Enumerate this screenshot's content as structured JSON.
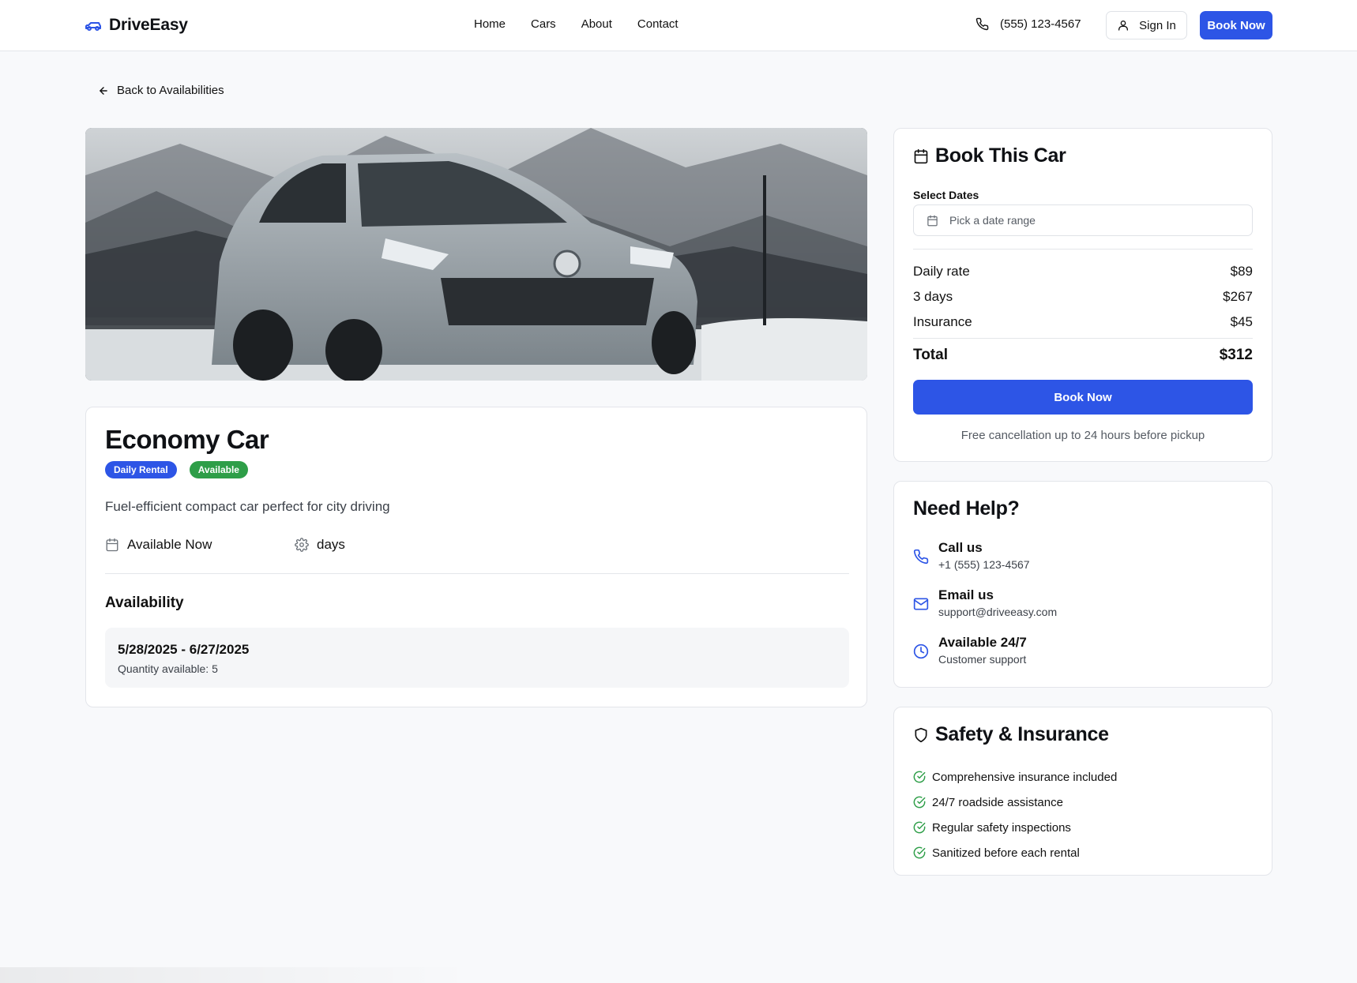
{
  "brand": {
    "name": "DriveEasy",
    "icon": "car-icon",
    "accent": "#2d55e6"
  },
  "nav": {
    "items": [
      {
        "label": "Home"
      },
      {
        "label": "Cars"
      },
      {
        "label": "About"
      },
      {
        "label": "Contact"
      }
    ],
    "phone": "(555) 123-4567",
    "sign_in": "Sign In",
    "book_now": "Book Now"
  },
  "back_link": "Back to Availabilities",
  "car": {
    "title": "Economy Car",
    "badges": [
      {
        "label": "Daily Rental",
        "color": "#2d55e6"
      },
      {
        "label": "Available",
        "color": "#2e9e48"
      }
    ],
    "description": "Fuel-efficient compact car perfect for city driving",
    "availability_status": "Available Now",
    "duration_unit": "days",
    "availability_title": "Availability",
    "availability": {
      "range": "5/28/2025 - 6/27/2025",
      "quantity": "Quantity available: 5"
    }
  },
  "booking": {
    "title": "Book This Car",
    "select_dates_label": "Select Dates",
    "date_placeholder": "Pick a date range",
    "rows": [
      {
        "label": "Daily rate",
        "value": "$89"
      },
      {
        "label": "3 days",
        "value": "$267"
      },
      {
        "label": "Insurance",
        "value": "$45"
      }
    ],
    "total": {
      "label": "Total",
      "value": "$312"
    },
    "button": "Book Now",
    "note": "Free cancellation up to 24 hours before pickup"
  },
  "help": {
    "title": "Need Help?",
    "items": [
      {
        "title": "Call us",
        "detail": "+1 (555) 123-4567",
        "icon": "phone-icon"
      },
      {
        "title": "Email us",
        "detail": "support@driveeasy.com",
        "icon": "mail-icon"
      },
      {
        "title": "Available 24/7",
        "detail": "Customer support",
        "icon": "clock-icon"
      }
    ]
  },
  "safety": {
    "title": "Safety & Insurance",
    "items": [
      "Comprehensive insurance included",
      "24/7 roadside assistance",
      "Regular safety inspections",
      "Sanitized before each rental"
    ]
  }
}
